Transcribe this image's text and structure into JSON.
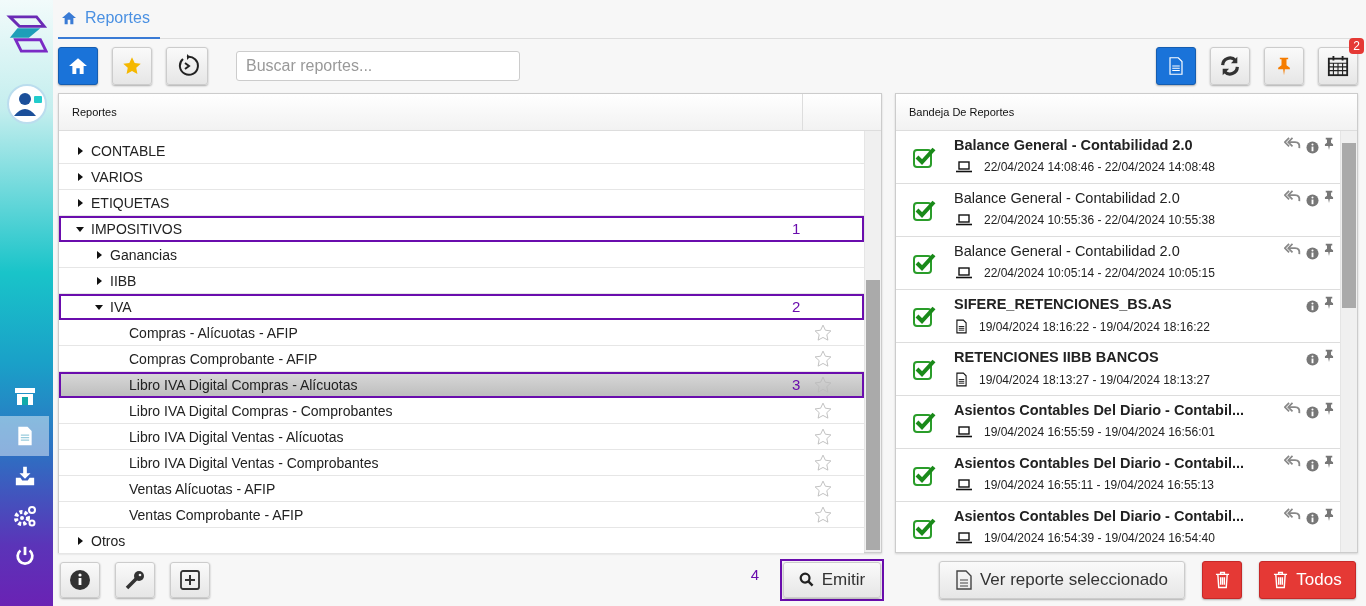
{
  "sidebar": {
    "nav": [
      {
        "kind": "store",
        "selected": false
      },
      {
        "kind": "document",
        "selected": true
      },
      {
        "kind": "download",
        "selected": false
      },
      {
        "kind": "settings",
        "selected": false
      },
      {
        "kind": "power",
        "selected": false
      }
    ]
  },
  "tab": {
    "label": "Reportes"
  },
  "toolbar": {
    "left": [
      {
        "kind": "home",
        "active": true
      },
      {
        "kind": "star",
        "active": false
      },
      {
        "kind": "history",
        "active": false
      }
    ],
    "search": {
      "placeholder": "Buscar reportes..."
    },
    "right": [
      {
        "kind": "document",
        "active": true
      },
      {
        "kind": "refresh",
        "active": false
      },
      {
        "kind": "pin",
        "active": false
      },
      {
        "kind": "calendar",
        "active": false,
        "badge": "2"
      }
    ]
  },
  "reports_panel": {
    "columns": [
      "Reportes"
    ],
    "tree": [
      {
        "label": "CONTABLE",
        "expanded": false
      },
      {
        "label": "VARIOS",
        "expanded": false
      },
      {
        "label": "ETIQUETAS",
        "expanded": false
      },
      {
        "label": "IMPOSITIVOS",
        "expanded": true,
        "callout": "1",
        "children": [
          {
            "label": "Ganancias",
            "expanded": false
          },
          {
            "label": "IIBB",
            "expanded": false
          },
          {
            "label": "IVA",
            "expanded": true,
            "callout": "2",
            "children": [
              {
                "label": "Compras - Alícuotas - AFIP",
                "favorite": false,
                "selected": false
              },
              {
                "label": "Compras Comprobante - AFIP",
                "favorite": false,
                "selected": false
              },
              {
                "label": "Libro IVA Digital Compras - Alícuotas",
                "favorite": false,
                "selected": true,
                "callout": "3"
              },
              {
                "label": "Libro IVA Digital Compras - Comprobantes",
                "favorite": false,
                "selected": false
              },
              {
                "label": "Libro IVA Digital Ventas - Alícuotas",
                "favorite": false,
                "selected": false
              },
              {
                "label": "Libro IVA Digital Ventas - Comprobantes",
                "favorite": false,
                "selected": false
              },
              {
                "label": "Ventas Alícuotas - AFIP",
                "favorite": false,
                "selected": false
              },
              {
                "label": "Ventas Comprobante - AFIP",
                "favorite": false,
                "selected": false
              }
            ]
          }
        ]
      },
      {
        "label": "Otros",
        "expanded": false
      }
    ]
  },
  "tray_panel": {
    "title": "Bandeja De Reportes",
    "items": [
      {
        "title": "Balance General - Contabilidad 2.0",
        "unread": true,
        "checked": true,
        "kind": "pc",
        "reply": true,
        "time": "22/04/2024 14:08:46 - 22/04/2024 14:08:48"
      },
      {
        "title": "Balance General - Contabilidad 2.0",
        "unread": false,
        "checked": true,
        "kind": "pc",
        "reply": true,
        "time": "22/04/2024 10:55:36 - 22/04/2024 10:55:38"
      },
      {
        "title": "Balance General - Contabilidad 2.0",
        "unread": false,
        "checked": true,
        "kind": "pc",
        "reply": true,
        "time": "22/04/2024 10:05:14 - 22/04/2024 10:05:15"
      },
      {
        "title": "SIFERE_RETENCIONES_BS.AS",
        "unread": true,
        "checked": true,
        "kind": "file",
        "reply": false,
        "time": "19/04/2024 18:16:22 - 19/04/2024 18:16:22"
      },
      {
        "title": "RETENCIONES IIBB BANCOS",
        "unread": true,
        "checked": true,
        "kind": "file",
        "reply": false,
        "time": "19/04/2024 18:13:27 - 19/04/2024 18:13:27"
      },
      {
        "title": "Asientos Contables Del Diario - Contabil...",
        "unread": true,
        "checked": true,
        "kind": "pc",
        "reply": true,
        "time": "19/04/2024 16:55:59 - 19/04/2024 16:56:01"
      },
      {
        "title": "Asientos Contables Del Diario - Contabil...",
        "unread": true,
        "checked": true,
        "kind": "pc",
        "reply": true,
        "time": "19/04/2024 16:55:11 - 19/04/2024 16:55:13"
      },
      {
        "title": "Asientos Contables Del Diario - Contabil...",
        "unread": true,
        "checked": true,
        "kind": "pc",
        "reply": true,
        "time": "19/04/2024 16:54:39 - 19/04/2024 16:54:40"
      }
    ]
  },
  "bottom_tools": [
    {
      "kind": "info"
    },
    {
      "kind": "key"
    },
    {
      "kind": "add"
    }
  ],
  "emit_button": {
    "label": "Emitir",
    "callout": "4"
  },
  "view_button": {
    "label": "Ver reporte seleccionado"
  },
  "delete_all_button": {
    "label": "Todos"
  }
}
